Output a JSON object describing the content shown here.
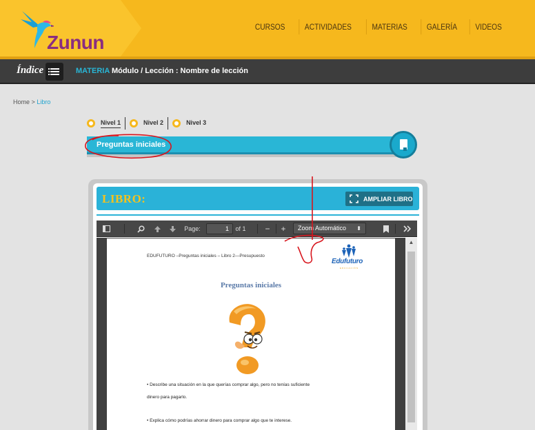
{
  "brand": {
    "logo_text": "Zunun"
  },
  "nav": {
    "items": [
      "CURSOS",
      "ACTIVIDADES",
      "MATERIAS",
      "GALERÍA",
      "VIDEOS"
    ]
  },
  "crumbbar": {
    "indice_label": "Índice",
    "materia_label": "MATERIA",
    "title": "Módulo / Lección : Nombre de lección"
  },
  "breadcrumb": {
    "home": "Home",
    "separator": ">",
    "current": "Libro"
  },
  "levels": [
    "Nivel 1",
    "Nivel 2",
    "Nivel 3"
  ],
  "section": {
    "title": "Preguntas iniciales"
  },
  "book": {
    "title": "LIBRO:",
    "expand_label": "AMPLIAR LIBRO"
  },
  "pdf_toolbar": {
    "page_label": "Page:",
    "page_value": "1",
    "of_label": "of 1",
    "zoom_label": "Zoom Automático",
    "minus": "−",
    "plus": "+"
  },
  "pdf_doc": {
    "header": "EDUFUTURO –Preguntas iniciales  – Libro 2—Presupuesto",
    "logo_text": "Edufuturo",
    "logo_tag": "EDUCACIÓN",
    "title": "Preguntas iniciales",
    "lines": [
      "• Describe una situación en la que querías comprar algo, pero no tenías suficiente",
      "dinero para pagarlo.",
      "• Explica cómo podrías ahorrar dinero para comprar algo que te interese."
    ]
  },
  "colors": {
    "header_yellow": "#f6b81d",
    "accent_blue": "#29b6d6",
    "dark_bar": "#3d3d3d",
    "annotation_red": "#d8141c"
  }
}
